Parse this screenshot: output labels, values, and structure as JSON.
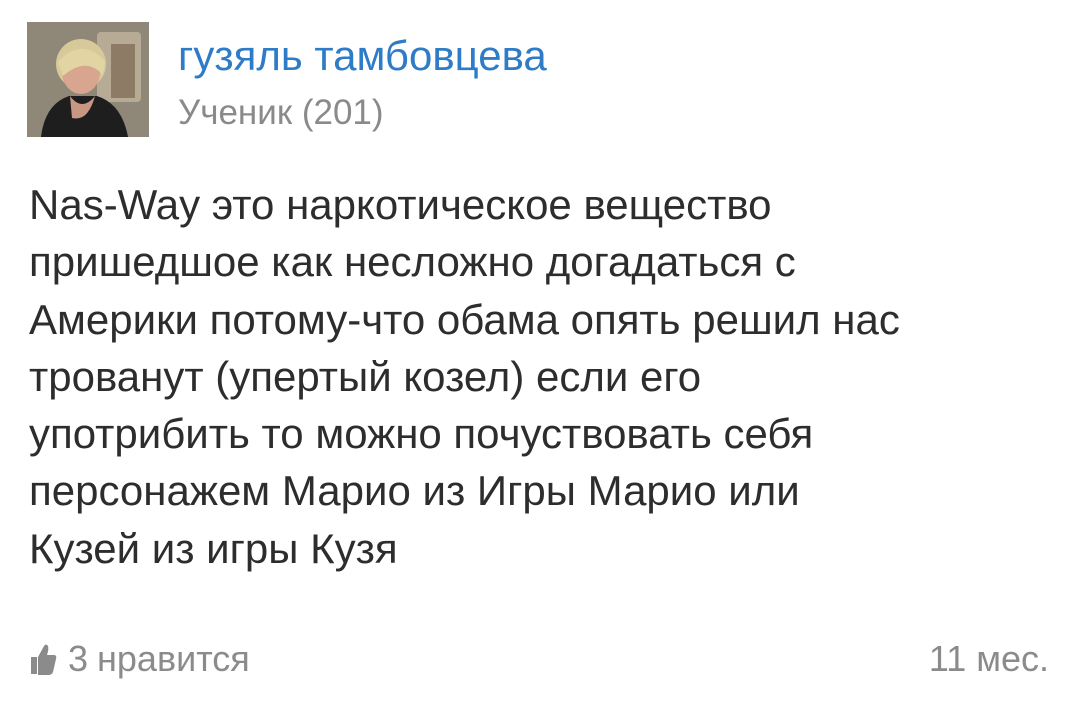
{
  "author": {
    "name": "гузяль тамбовцева",
    "rank": "Ученик (201)"
  },
  "answer": {
    "lines": [
      "Nas-Way это наркотическое вещество",
      "пришедшое как несложно догадаться с",
      "Америки потому-что обама опять решил нас",
      "трованут (упертый козел) если его",
      "употрибить то можно почуствовать себя",
      "персонажем Марио из Игры Марио или",
      "Кузей из игры Кузя"
    ]
  },
  "footer": {
    "like_icon": "thumbs-up-icon",
    "like_count": "3",
    "like_label": "нравится",
    "timestamp": "11 мес."
  },
  "colors": {
    "author_name": "#2e7cc7",
    "secondary_text": "#8a8a8a",
    "body_text": "#2d2d2d",
    "background": "#ffffff"
  }
}
